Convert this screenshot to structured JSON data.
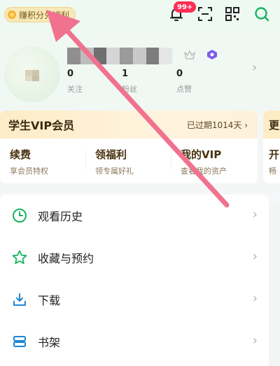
{
  "header": {
    "points_label": "赚积分兑福利",
    "notification_badge": "99+"
  },
  "profile": {
    "stats": [
      {
        "value": "0",
        "label": "关注"
      },
      {
        "value": "1",
        "label": "粉丝"
      },
      {
        "value": "0",
        "label": "点赞"
      }
    ]
  },
  "vip": {
    "title": "学生VIP会员",
    "expire": "已过期1014天 ›",
    "items": [
      {
        "title": "续费",
        "subtitle": "享会员特权"
      },
      {
        "title": "领福利",
        "subtitle": "领专属好礼"
      },
      {
        "title": "我的VIP",
        "subtitle": "查看我的资产"
      }
    ],
    "side_head": "更",
    "side_title": "开",
    "side_sub": "畅"
  },
  "menu": {
    "items": [
      {
        "label": "观看历史",
        "icon": "clock-icon"
      },
      {
        "label": "收藏与预约",
        "icon": "star-icon"
      },
      {
        "label": "下载",
        "icon": "download-icon"
      },
      {
        "label": "书架",
        "icon": "bookshelf-icon"
      }
    ]
  },
  "colors": {
    "accent_green": "#16b35e",
    "annotation_arrow": "#f0728f",
    "badge_red": "#ff2d55"
  }
}
